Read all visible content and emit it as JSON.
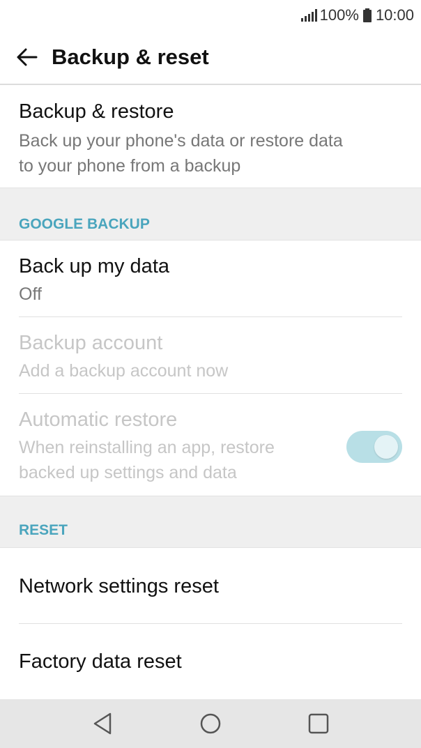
{
  "status_bar": {
    "battery_percent": "100%",
    "time": "10:00",
    "signal_icon": "signal-icon",
    "battery_icon": "battery-icon"
  },
  "app_bar": {
    "back_icon": "arrow-left-icon",
    "title": "Backup & reset"
  },
  "backup_restore": {
    "title": "Backup & restore",
    "subtitle_line1": "Back up your phone's data or restore data",
    "subtitle_line2": "to your phone from a backup"
  },
  "google_backup": {
    "header": "GOOGLE BACKUP",
    "back_up_my_data": {
      "title": "Back up my data",
      "value": "Off"
    },
    "backup_account": {
      "title": "Backup account",
      "subtitle": "Add a backup account now"
    },
    "automatic_restore": {
      "title": "Automatic restore",
      "subtitle_line1": "When reinstalling an app, restore",
      "subtitle_line2": "backed up settings and data",
      "toggle_on": true
    }
  },
  "reset": {
    "header": "RESET",
    "network_settings_reset": "Network settings reset",
    "factory_data_reset": "Factory data reset"
  },
  "nav_bar": {
    "back_icon": "nav-back-triangle-icon",
    "home_icon": "nav-home-circle-icon",
    "recents_icon": "nav-recents-square-icon"
  },
  "colors": {
    "accent": "#4aa5bd",
    "toggle_track": "#b8dfe6",
    "section_bg": "#efefef",
    "nav_bg": "#e6e6e6"
  }
}
